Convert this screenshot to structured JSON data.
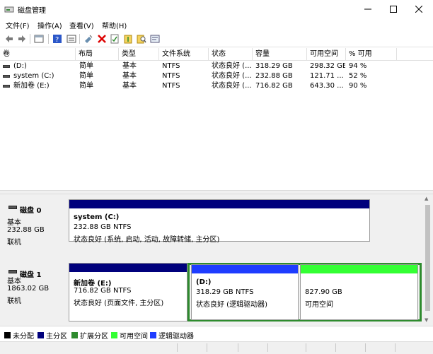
{
  "window": {
    "title": "磁盘管理"
  },
  "menu": {
    "items": [
      "文件(F)",
      "操作(A)",
      "查看(V)",
      "帮助(H)"
    ]
  },
  "toolbar": {
    "icons": [
      "back-icon",
      "forward-icon",
      "console-icon",
      "help-icon",
      "list-icon",
      "connect-icon",
      "delete-icon",
      "properties-icon",
      "new-icon",
      "search-icon",
      "refresh-icon"
    ]
  },
  "volumes": {
    "headers": [
      "卷",
      "布局",
      "类型",
      "文件系统",
      "状态",
      "容量",
      "可用空间",
      "% 可用"
    ],
    "rows": [
      [
        "(D:)",
        "简单",
        "基本",
        "NTFS",
        "状态良好 (...",
        "318.29 GB",
        "298.32 GB",
        "94 %"
      ],
      [
        "system (C:)",
        "简单",
        "基本",
        "NTFS",
        "状态良好 (...",
        "232.88 GB",
        "121.71 ...",
        "52 %"
      ],
      [
        "新加卷 (E:)",
        "简单",
        "基本",
        "NTFS",
        "状态良好 (...",
        "716.82 GB",
        "643.30 ...",
        "90 %"
      ]
    ]
  },
  "disks": [
    {
      "name": "磁盘 0",
      "type": "基本",
      "size": "232.88 GB",
      "state": "联机",
      "partitions": [
        {
          "label": "system  (C:)",
          "size": "232.88 GB NTFS",
          "status": "状态良好 (系统, 启动, 活动, 故障转储, 主分区)",
          "color": "#00007c"
        }
      ]
    },
    {
      "name": "磁盘 1",
      "type": "基本",
      "size": "1863.02 GB",
      "state": "联机",
      "partitions": [
        {
          "label": "新加卷  (E:)",
          "size": "716.82 GB NTFS",
          "status": "状态良好 (页面文件, 主分区)",
          "color": "#00007c"
        },
        {
          "label": "(D:)",
          "size": "318.29 GB NTFS",
          "status": "状态良好 (逻辑驱动器)",
          "color": "#1e3cff"
        },
        {
          "label": "",
          "size": "827.90 GB",
          "status": "可用空间",
          "color": "#33ff33"
        }
      ]
    }
  ],
  "legend": [
    {
      "label": "未分配",
      "color": "#000000"
    },
    {
      "label": "主分区",
      "color": "#00007c"
    },
    {
      "label": "扩展分区",
      "color": "#2e8b2e"
    },
    {
      "label": "可用空间",
      "color": "#33ff33"
    },
    {
      "label": "逻辑驱动器",
      "color": "#1e3cff"
    }
  ]
}
